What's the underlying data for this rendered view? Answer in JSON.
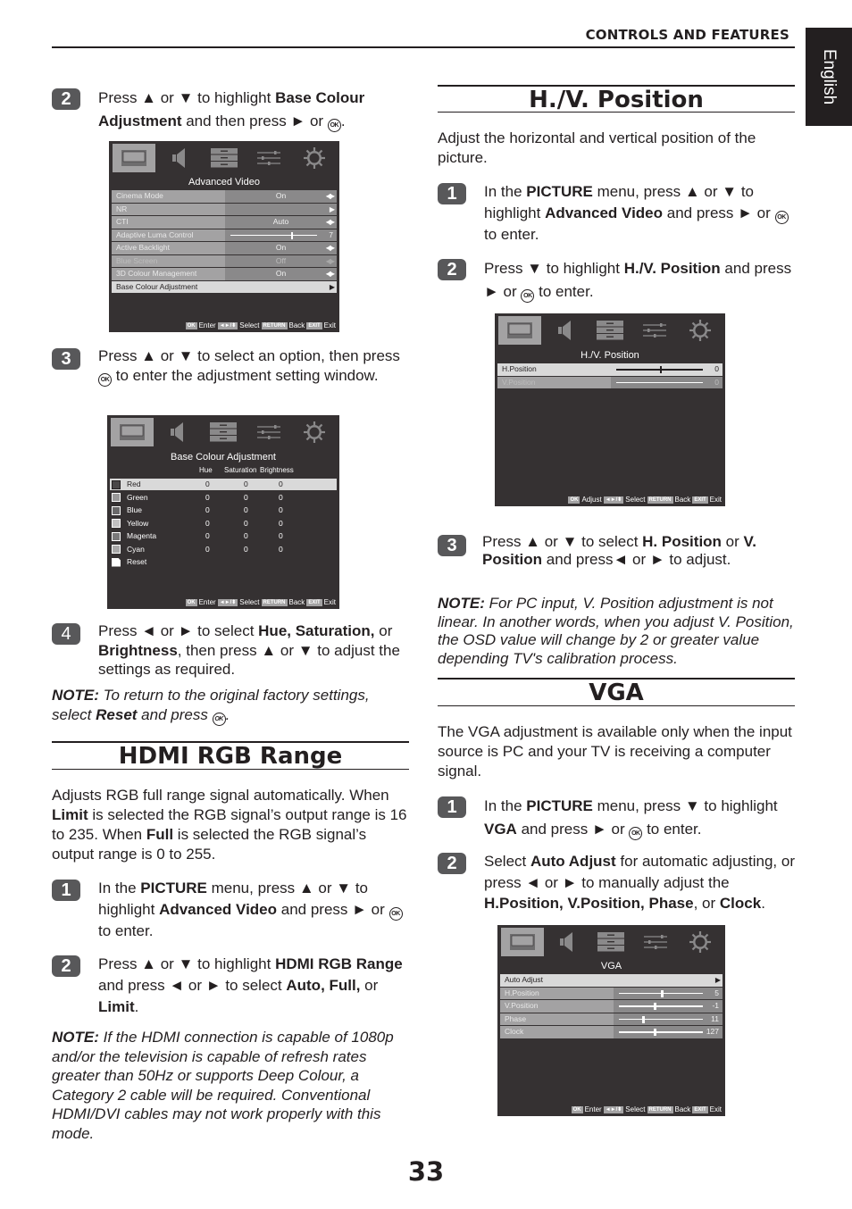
{
  "header": {
    "section": "CONTROLS AND FEATURES",
    "language_tab": "English"
  },
  "page_number": "33",
  "symbols": {
    "ok": "OK"
  },
  "left_column": {
    "base_colour_steps": [
      {
        "number": "2",
        "segments": [
          [
            "Press ▲ or ▼ to highlight ",
            ""
          ],
          [
            "Base Colour Adjustment",
            "b"
          ],
          [
            " and then press ► or ",
            ""
          ],
          [
            "OK",
            "ok"
          ],
          [
            ".",
            ""
          ]
        ]
      },
      {
        "number": "3",
        "segments": [
          [
            "Press ▲ or ▼ to select an option, then press ",
            ""
          ],
          [
            "OK",
            "ok"
          ],
          [
            " to enter the adjustment setting window.",
            ""
          ]
        ]
      },
      {
        "number": "4",
        "segments": [
          [
            "Press ◄ or ► to select ",
            ""
          ],
          [
            "Hue, Saturation,",
            "b"
          ],
          [
            " or ",
            ""
          ],
          [
            "Brightness",
            "b"
          ],
          [
            ", then press ▲ or ▼ to adjust the settings as required.",
            ""
          ]
        ]
      }
    ],
    "reset_note": [
      [
        "NOTE:",
        "b"
      ],
      [
        " To return to the original factory settings, select ",
        ""
      ],
      [
        "Reset",
        "b"
      ],
      [
        " and press ",
        ""
      ],
      [
        "OK",
        "ok"
      ],
      [
        ".",
        ""
      ]
    ],
    "hdmi_section": {
      "title": "HDMI RGB Range",
      "intro": [
        [
          "Adjusts RGB full range signal automatically. When ",
          ""
        ],
        [
          "Limit",
          "b"
        ],
        [
          " is selected the RGB signal’s output range is 16 to 235. When ",
          ""
        ],
        [
          "Full",
          "b"
        ],
        [
          " is selected the RGB signal’s output range is 0 to 255.",
          ""
        ]
      ],
      "steps": [
        {
          "number": "1",
          "segments": [
            [
              "In the ",
              ""
            ],
            [
              "PICTURE",
              "b"
            ],
            [
              " menu, press ▲ or ▼ to highlight ",
              ""
            ],
            [
              "Advanced Video",
              "b"
            ],
            [
              " and press ► or ",
              ""
            ],
            [
              "OK",
              "ok"
            ],
            [
              " to enter.",
              ""
            ]
          ]
        },
        {
          "number": "2",
          "segments": [
            [
              "Press ▲ or ▼ to highlight ",
              ""
            ],
            [
              "HDMI RGB Range",
              "b"
            ],
            [
              " and press ◄ or ► to select ",
              ""
            ],
            [
              "Auto, Full,",
              "b"
            ],
            [
              " or ",
              ""
            ],
            [
              "Limit",
              "b"
            ],
            [
              ".",
              ""
            ]
          ]
        }
      ],
      "note": [
        [
          "NOTE:",
          "b"
        ],
        [
          " If the HDMI connection is capable of 1080p and/or the television is capable of refresh rates greater than 50Hz or supports Deep Colour, a Category 2 cable will be required. Conventional HDMI/DVI cables may not work properly with this mode.",
          ""
        ]
      ]
    }
  },
  "right_column": {
    "hv_section": {
      "title": "H./V. Position",
      "intro": "Adjust the horizontal and vertical position of the picture.",
      "steps": [
        {
          "number": "1",
          "segments": [
            [
              "In the ",
              ""
            ],
            [
              "PICTURE",
              "b"
            ],
            [
              " menu, press ▲ or ▼ to highlight ",
              ""
            ],
            [
              "Advanced Video",
              "b"
            ],
            [
              " and press ► or ",
              ""
            ],
            [
              "OK",
              "ok"
            ],
            [
              " to enter.",
              ""
            ]
          ]
        },
        {
          "number": "2",
          "segments": [
            [
              "Press ▼ to highlight ",
              ""
            ],
            [
              "H./V. Position",
              "b"
            ],
            [
              " and press ► or ",
              ""
            ],
            [
              "OK",
              "ok"
            ],
            [
              " to enter.",
              ""
            ]
          ]
        },
        {
          "number": "3",
          "segments": [
            [
              "Press ▲ or ▼ to select ",
              ""
            ],
            [
              "H. Position",
              "b"
            ],
            [
              " or ",
              ""
            ],
            [
              "V. Position",
              "b"
            ],
            [
              " and press◄ or ► to adjust.",
              ""
            ]
          ]
        }
      ],
      "note": [
        [
          "NOTE:",
          "b"
        ],
        [
          " For PC input, V. Position adjustment is not linear.  In another words, when you adjust V. Position, the OSD value will change by 2 or greater value depending TV's calibration process.",
          ""
        ]
      ]
    },
    "vga_section": {
      "title": "VGA",
      "intro": "The VGA adjustment is available only when the input source is PC and your TV is receiving a computer signal.",
      "steps": [
        {
          "number": "1",
          "segments": [
            [
              "In the ",
              ""
            ],
            [
              "PICTURE",
              "b"
            ],
            [
              " menu, press ▼ to highlight ",
              ""
            ],
            [
              "VGA",
              "b"
            ],
            [
              " and press ► or ",
              ""
            ],
            [
              "OK",
              "ok"
            ],
            [
              " to enter.",
              ""
            ]
          ]
        },
        {
          "number": "2",
          "segments": [
            [
              "Select ",
              ""
            ],
            [
              "Auto Adjust",
              "b"
            ],
            [
              " for automatic adjusting, or press ◄ or ► to manually adjust the ",
              ""
            ],
            [
              "H.Position, V.Position, Phase",
              "b"
            ],
            [
              ", or ",
              ""
            ],
            [
              "Clock",
              "b"
            ],
            [
              ".",
              ""
            ]
          ]
        }
      ]
    }
  },
  "osd_common": {
    "icons": [
      "picture-icon",
      "sound-icon",
      "setup-icon",
      "preferences-icon",
      "settings-icon"
    ],
    "keys": {
      "ok": "OK",
      "nav": "◄►/⬍",
      "return": "RETURN",
      "exit": "EXIT"
    },
    "labels": {
      "select": "Select",
      "back": "Back",
      "exit": "Exit"
    }
  },
  "osd_advanced_video": {
    "title": "Advanced Video",
    "footer_action": "Enter",
    "rows": [
      {
        "label": "Cinema Mode",
        "value": "On",
        "type": "option",
        "state": ""
      },
      {
        "label": "NR",
        "value": "",
        "type": "submenu",
        "state": ""
      },
      {
        "label": "CTI",
        "value": "Auto",
        "type": "option",
        "state": ""
      },
      {
        "label": "Adaptive Luma Control",
        "value": "7",
        "type": "slider",
        "fraction": 0.7,
        "state": ""
      },
      {
        "label": "Active Backlight",
        "value": "On",
        "type": "option",
        "state": ""
      },
      {
        "label": "Blue Screen",
        "value": "Off",
        "type": "option",
        "state": "dim"
      },
      {
        "label": "3D Colour Management",
        "value": "On",
        "type": "option",
        "state": ""
      },
      {
        "label": "Base Colour Adjustment",
        "value": "",
        "type": "submenu",
        "state": "sel"
      }
    ]
  },
  "osd_base_colour": {
    "title": "Base Colour Adjustment",
    "footer_action": "Enter",
    "columns": [
      "Hue",
      "Saturation",
      "Brightness"
    ],
    "rows": [
      {
        "name": "Red",
        "values": [
          "0",
          "0",
          "0"
        ],
        "swatch": "#4a4748",
        "selected": true
      },
      {
        "name": "Green",
        "values": [
          "0",
          "0",
          "0"
        ],
        "swatch": "#9a999a",
        "selected": false
      },
      {
        "name": "Blue",
        "values": [
          "0",
          "0",
          "0"
        ],
        "swatch": "#6a696a",
        "selected": false
      },
      {
        "name": "Yellow",
        "values": [
          "0",
          "0",
          "0"
        ],
        "swatch": "#c2c1c2",
        "selected": false
      },
      {
        "name": "Magenta",
        "values": [
          "0",
          "0",
          "0"
        ],
        "swatch": "#7a797a",
        "selected": false
      },
      {
        "name": "Cyan",
        "values": [
          "0",
          "0",
          "0"
        ],
        "swatch": "#a9a8a9",
        "selected": false
      },
      {
        "name": "Reset",
        "values": [
          "",
          "",
          ""
        ],
        "swatch": "reset",
        "selected": false
      }
    ]
  },
  "osd_hv_position": {
    "title": "H./V. Position",
    "footer_action": "Adjust",
    "rows": [
      {
        "label": "H.Position",
        "value": "0",
        "type": "slider",
        "fraction": 0.5,
        "state": "sel"
      },
      {
        "label": "V.Position",
        "value": "0",
        "type": "slider",
        "fraction": null,
        "state": "dim"
      }
    ]
  },
  "osd_vga": {
    "title": "VGA",
    "footer_action": "Enter",
    "rows": [
      {
        "label": "Auto Adjust",
        "value": "",
        "type": "submenu",
        "state": "sel"
      },
      {
        "label": "H.Position",
        "value": "5",
        "type": "slider",
        "fraction": 0.5,
        "state": ""
      },
      {
        "label": "V.Position",
        "value": "-1",
        "type": "slider",
        "fraction": 0.42,
        "state": ""
      },
      {
        "label": "Phase",
        "value": "11",
        "type": "slider",
        "fraction": 0.28,
        "state": ""
      },
      {
        "label": "Clock",
        "value": "127",
        "type": "slider",
        "fraction": 0.42,
        "state": ""
      }
    ]
  }
}
